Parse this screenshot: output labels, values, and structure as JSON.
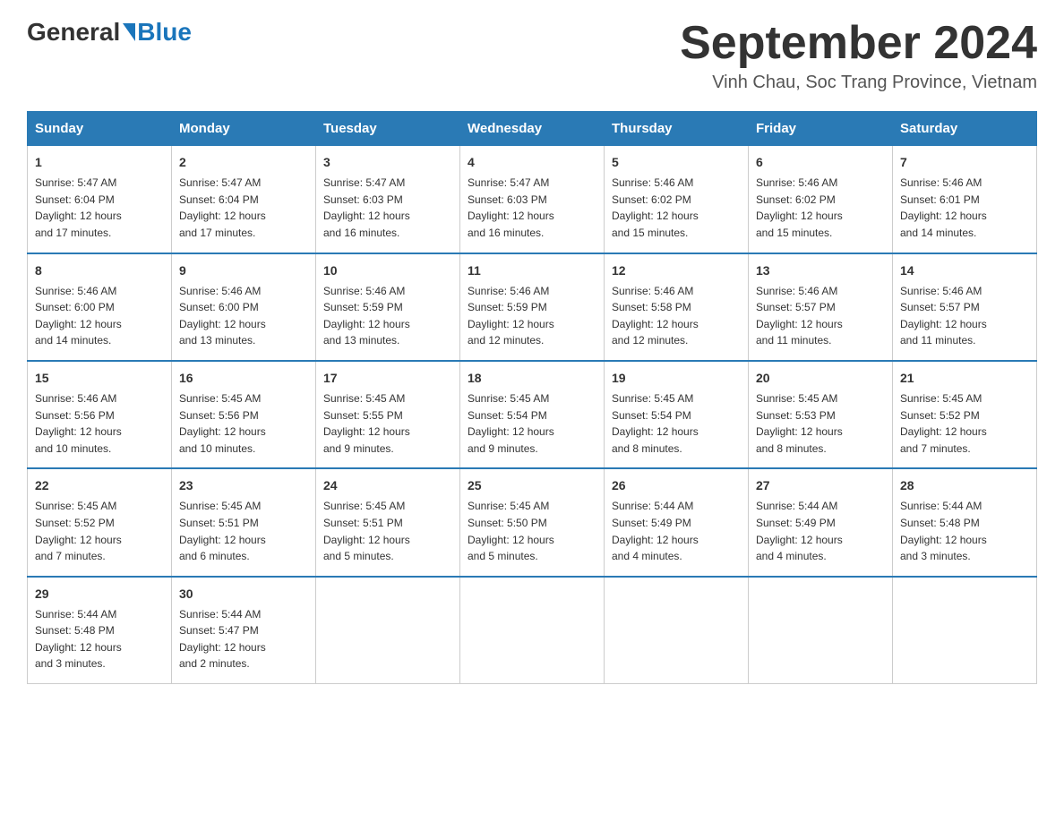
{
  "logo": {
    "general": "General",
    "blue": "Blue"
  },
  "title": "September 2024",
  "location": "Vinh Chau, Soc Trang Province, Vietnam",
  "days_header": [
    "Sunday",
    "Monday",
    "Tuesday",
    "Wednesday",
    "Thursday",
    "Friday",
    "Saturday"
  ],
  "weeks": [
    [
      {
        "day": "1",
        "sunrise": "5:47 AM",
        "sunset": "6:04 PM",
        "daylight": "12 hours and 17 minutes."
      },
      {
        "day": "2",
        "sunrise": "5:47 AM",
        "sunset": "6:04 PM",
        "daylight": "12 hours and 17 minutes."
      },
      {
        "day": "3",
        "sunrise": "5:47 AM",
        "sunset": "6:03 PM",
        "daylight": "12 hours and 16 minutes."
      },
      {
        "day": "4",
        "sunrise": "5:47 AM",
        "sunset": "6:03 PM",
        "daylight": "12 hours and 16 minutes."
      },
      {
        "day": "5",
        "sunrise": "5:46 AM",
        "sunset": "6:02 PM",
        "daylight": "12 hours and 15 minutes."
      },
      {
        "day": "6",
        "sunrise": "5:46 AM",
        "sunset": "6:02 PM",
        "daylight": "12 hours and 15 minutes."
      },
      {
        "day": "7",
        "sunrise": "5:46 AM",
        "sunset": "6:01 PM",
        "daylight": "12 hours and 14 minutes."
      }
    ],
    [
      {
        "day": "8",
        "sunrise": "5:46 AM",
        "sunset": "6:00 PM",
        "daylight": "12 hours and 14 minutes."
      },
      {
        "day": "9",
        "sunrise": "5:46 AM",
        "sunset": "6:00 PM",
        "daylight": "12 hours and 13 minutes."
      },
      {
        "day": "10",
        "sunrise": "5:46 AM",
        "sunset": "5:59 PM",
        "daylight": "12 hours and 13 minutes."
      },
      {
        "day": "11",
        "sunrise": "5:46 AM",
        "sunset": "5:59 PM",
        "daylight": "12 hours and 12 minutes."
      },
      {
        "day": "12",
        "sunrise": "5:46 AM",
        "sunset": "5:58 PM",
        "daylight": "12 hours and 12 minutes."
      },
      {
        "day": "13",
        "sunrise": "5:46 AM",
        "sunset": "5:57 PM",
        "daylight": "12 hours and 11 minutes."
      },
      {
        "day": "14",
        "sunrise": "5:46 AM",
        "sunset": "5:57 PM",
        "daylight": "12 hours and 11 minutes."
      }
    ],
    [
      {
        "day": "15",
        "sunrise": "5:46 AM",
        "sunset": "5:56 PM",
        "daylight": "12 hours and 10 minutes."
      },
      {
        "day": "16",
        "sunrise": "5:45 AM",
        "sunset": "5:56 PM",
        "daylight": "12 hours and 10 minutes."
      },
      {
        "day": "17",
        "sunrise": "5:45 AM",
        "sunset": "5:55 PM",
        "daylight": "12 hours and 9 minutes."
      },
      {
        "day": "18",
        "sunrise": "5:45 AM",
        "sunset": "5:54 PM",
        "daylight": "12 hours and 9 minutes."
      },
      {
        "day": "19",
        "sunrise": "5:45 AM",
        "sunset": "5:54 PM",
        "daylight": "12 hours and 8 minutes."
      },
      {
        "day": "20",
        "sunrise": "5:45 AM",
        "sunset": "5:53 PM",
        "daylight": "12 hours and 8 minutes."
      },
      {
        "day": "21",
        "sunrise": "5:45 AM",
        "sunset": "5:52 PM",
        "daylight": "12 hours and 7 minutes."
      }
    ],
    [
      {
        "day": "22",
        "sunrise": "5:45 AM",
        "sunset": "5:52 PM",
        "daylight": "12 hours and 7 minutes."
      },
      {
        "day": "23",
        "sunrise": "5:45 AM",
        "sunset": "5:51 PM",
        "daylight": "12 hours and 6 minutes."
      },
      {
        "day": "24",
        "sunrise": "5:45 AM",
        "sunset": "5:51 PM",
        "daylight": "12 hours and 5 minutes."
      },
      {
        "day": "25",
        "sunrise": "5:45 AM",
        "sunset": "5:50 PM",
        "daylight": "12 hours and 5 minutes."
      },
      {
        "day": "26",
        "sunrise": "5:44 AM",
        "sunset": "5:49 PM",
        "daylight": "12 hours and 4 minutes."
      },
      {
        "day": "27",
        "sunrise": "5:44 AM",
        "sunset": "5:49 PM",
        "daylight": "12 hours and 4 minutes."
      },
      {
        "day": "28",
        "sunrise": "5:44 AM",
        "sunset": "5:48 PM",
        "daylight": "12 hours and 3 minutes."
      }
    ],
    [
      {
        "day": "29",
        "sunrise": "5:44 AM",
        "sunset": "5:48 PM",
        "daylight": "12 hours and 3 minutes."
      },
      {
        "day": "30",
        "sunrise": "5:44 AM",
        "sunset": "5:47 PM",
        "daylight": "12 hours and 2 minutes."
      },
      null,
      null,
      null,
      null,
      null
    ]
  ],
  "labels": {
    "sunrise": "Sunrise:",
    "sunset": "Sunset:",
    "daylight": "Daylight:"
  }
}
